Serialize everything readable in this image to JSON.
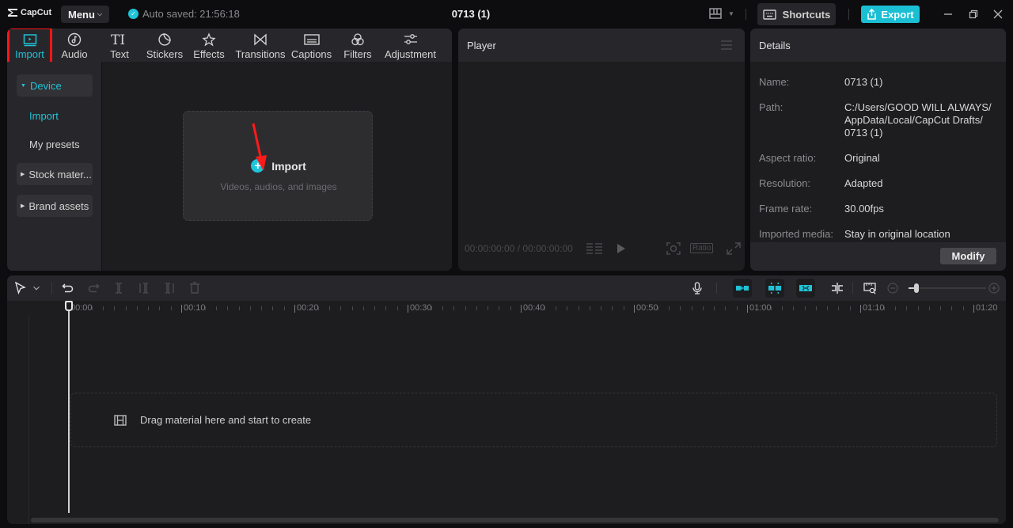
{
  "app": {
    "name": "CapCut",
    "menu_label": "Menu",
    "autosave_text": "Auto saved: 21:56:18",
    "project_title": "0713 (1)",
    "shortcuts_label": "Shortcuts",
    "export_label": "Export",
    "accent_color": "#1bbfd4"
  },
  "toolbar": {
    "tabs": [
      {
        "label": "Import",
        "icon": "import-media-icon",
        "active": true
      },
      {
        "label": "Audio",
        "icon": "audio-note-icon"
      },
      {
        "label": "Text",
        "icon": "text-ti-icon"
      },
      {
        "label": "Stickers",
        "icon": "sticker-icon"
      },
      {
        "label": "Effects",
        "icon": "sparkle-star-icon"
      },
      {
        "label": "Transitions",
        "icon": "bowtie-icon"
      },
      {
        "label": "Captions",
        "icon": "captions-icon"
      },
      {
        "label": "Filters",
        "icon": "filters-circles-icon"
      },
      {
        "label": "Adjustment",
        "icon": "sliders-icon"
      }
    ]
  },
  "sidebar": {
    "device_label": "Device",
    "import_label": "Import",
    "presets_label": "My presets",
    "stock_label": "Stock mater...",
    "brand_label": "Brand assets"
  },
  "import_card": {
    "title": "Import",
    "subtitle": "Videos, audios, and images"
  },
  "player": {
    "title": "Player",
    "timecode": "00:00:00:00 / 00:00:00:00",
    "ratio_label": "Ratio"
  },
  "details": {
    "title": "Details",
    "rows": [
      {
        "label": "Name:",
        "value": "0713 (1)"
      },
      {
        "label": "Path:",
        "value": "C:/Users/GOOD WILL ALWAYS/ AppData/Local/CapCut Drafts/ 0713 (1)"
      },
      {
        "label": "Aspect ratio:",
        "value": "Original"
      },
      {
        "label": "Resolution:",
        "value": "Adapted"
      },
      {
        "label": "Frame rate:",
        "value": "30.00fps"
      },
      {
        "label": "Imported media:",
        "value": "Stay in original location"
      }
    ],
    "modify_label": "Modify"
  },
  "timeline": {
    "ruler_labels": [
      "00:00",
      "00:10",
      "00:20",
      "00:30",
      "00:40",
      "00:50",
      "01:00",
      "01:10",
      "01:20"
    ],
    "drop_text": "Drag material here and start to create",
    "zoom_level": 0.1
  }
}
